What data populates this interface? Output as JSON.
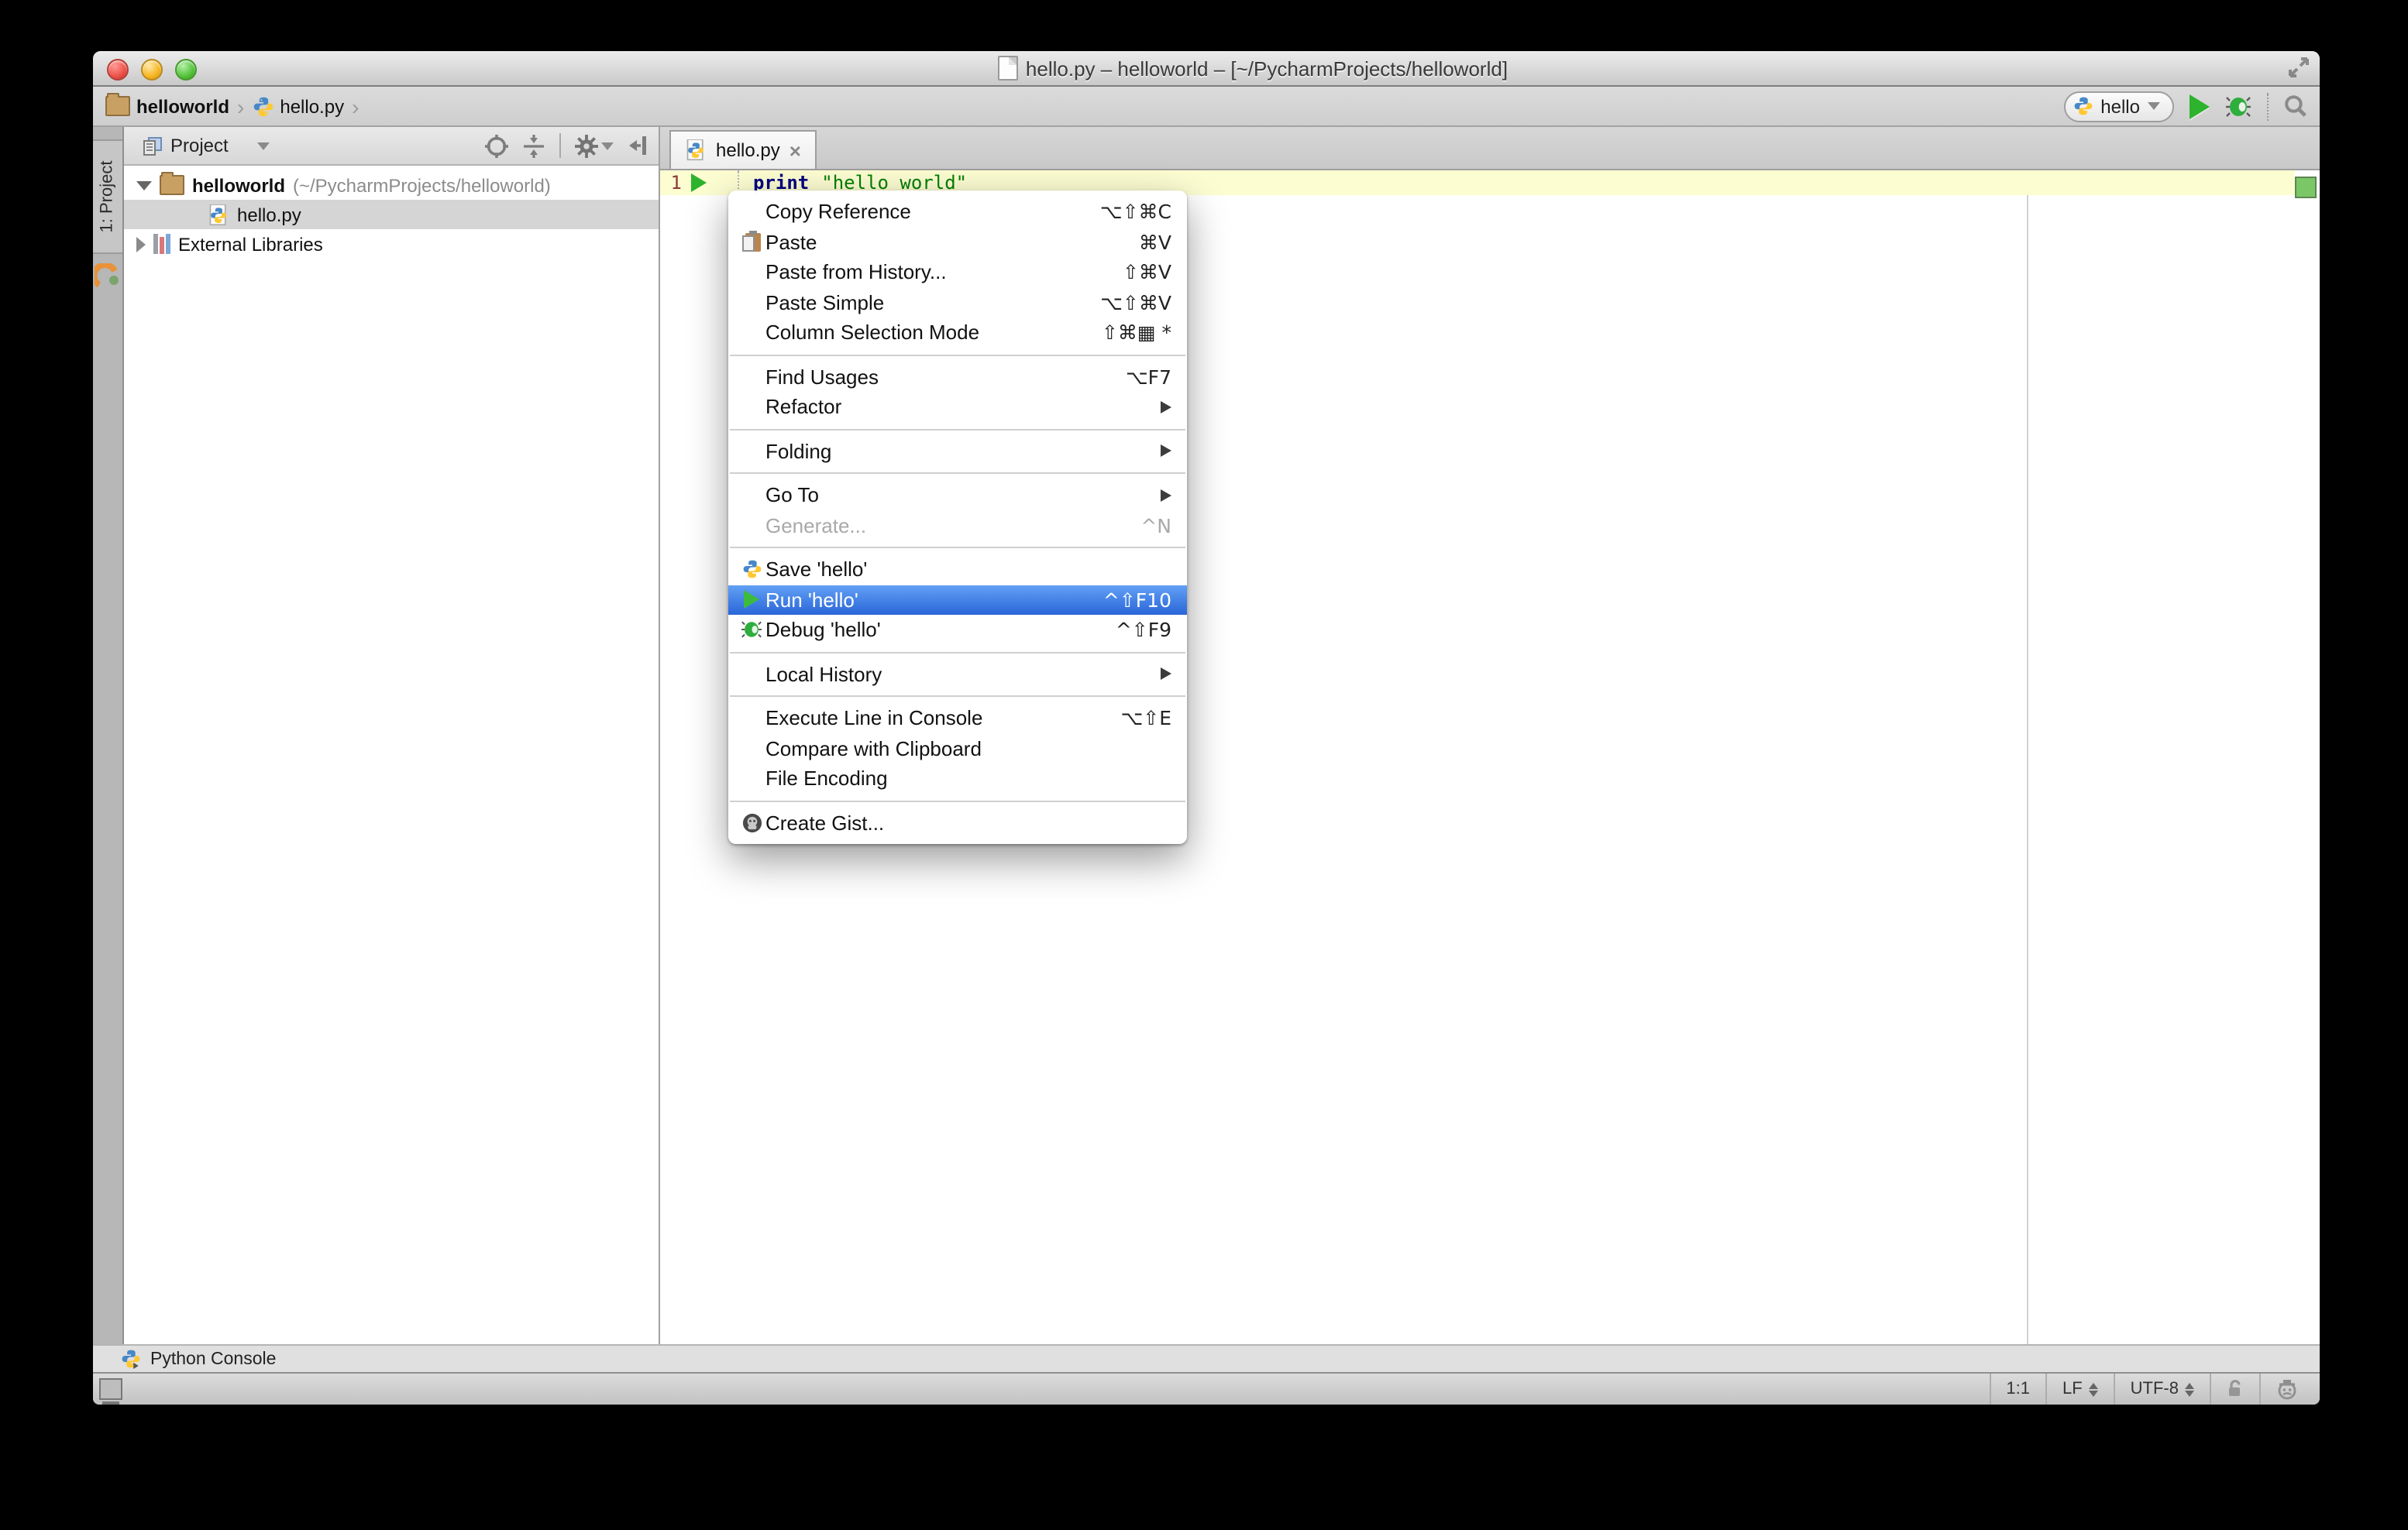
{
  "window": {
    "title": "hello.py – helloworld – [~/PycharmProjects/helloworld]"
  },
  "toolbar": {
    "breadcrumbs": [
      {
        "label": "helloworld"
      },
      {
        "label": "hello.py"
      }
    ],
    "run_config_name": "hello"
  },
  "left_strip": {
    "project_button_label": "1: Project"
  },
  "project_panel": {
    "header_title": "Project",
    "root_label": "helloworld",
    "root_path": "(~/PycharmProjects/helloworld)",
    "file_label": "hello.py",
    "libraries_label": "External Libraries"
  },
  "editor": {
    "tab_label": "hello.py",
    "tab_close": "×",
    "line_number": "1",
    "code_keyword": "print",
    "code_string": "\"hello world\""
  },
  "context_menu": {
    "items": [
      {
        "label": "Copy Reference",
        "shortcut": "⌥⇧⌘C"
      },
      {
        "label": "Paste",
        "shortcut": "⌘V"
      },
      {
        "label": "Paste from History...",
        "shortcut": "⇧⌘V"
      },
      {
        "label": "Paste Simple",
        "shortcut": "⌥⇧⌘V"
      },
      {
        "label": "Column Selection Mode",
        "shortcut": "⇧⌘▦ *"
      },
      {
        "label": "Find Usages",
        "shortcut": "⌥F7"
      },
      {
        "label": "Refactor",
        "shortcut": ""
      },
      {
        "label": "Folding",
        "shortcut": ""
      },
      {
        "label": "Go To",
        "shortcut": ""
      },
      {
        "label": "Generate...",
        "shortcut": "^N"
      },
      {
        "label": "Save 'hello'",
        "shortcut": ""
      },
      {
        "label": "Run 'hello'",
        "shortcut": "^⇧F10"
      },
      {
        "label": "Debug 'hello'",
        "shortcut": "^⇧F9"
      },
      {
        "label": "Local History",
        "shortcut": ""
      },
      {
        "label": "Execute Line in Console",
        "shortcut": "⌥⇧E"
      },
      {
        "label": "Compare with Clipboard",
        "shortcut": ""
      },
      {
        "label": "File Encoding",
        "shortcut": ""
      },
      {
        "label": "Create Gist...",
        "shortcut": ""
      }
    ]
  },
  "bottom": {
    "python_console_label": "Python Console"
  },
  "status_bar": {
    "caret_position": "1:1",
    "line_separator": "LF",
    "encoding": "UTF-8"
  },
  "colors": {
    "menu_selection_blue": "#2a66d8",
    "run_green": "#2db32d",
    "current_line_yellow": "#fdfdd2",
    "marker_green": "#7bc768",
    "keyword_blue": "#000080",
    "string_green": "#008000"
  }
}
